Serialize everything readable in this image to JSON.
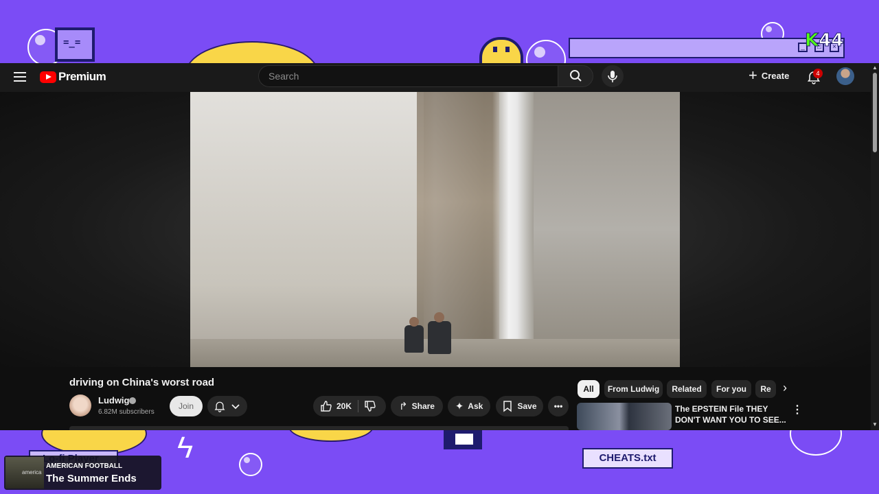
{
  "desktop": {
    "pixel_monitor_face": "=_=",
    "kick_logo": {
      "k": "K",
      "number": "44"
    },
    "lofi_label": "Lo-fi Player",
    "cheats_label": "CHEATS.txt",
    "now_playing": {
      "artist": "AMERICAN FOOTBALL",
      "song": "The Summer Ends",
      "art_text": "america"
    }
  },
  "header": {
    "logo_text": "Premium",
    "search_placeholder": "Search",
    "create_label": "Create",
    "notification_count": "4"
  },
  "video": {
    "title": "driving on China's worst road",
    "channel": {
      "name": "Ludwig",
      "subscribers": "6.82M subscribers"
    },
    "join_label": "Join",
    "like_count": "20K",
    "share_label": "Share",
    "ask_label": "Ask",
    "save_label": "Save"
  },
  "chips": [
    "All",
    "From Ludwig",
    "Related",
    "For you",
    "Re"
  ],
  "recommendation": {
    "title": "The EPSTEIN File THEY DON'T WANT YOU TO SEE..."
  },
  "colors": {
    "desktop_bg": "#7b4cf5",
    "yt_bg": "#0f0f0f",
    "yt_red": "#ff0000",
    "kick_green": "#53fc18"
  }
}
